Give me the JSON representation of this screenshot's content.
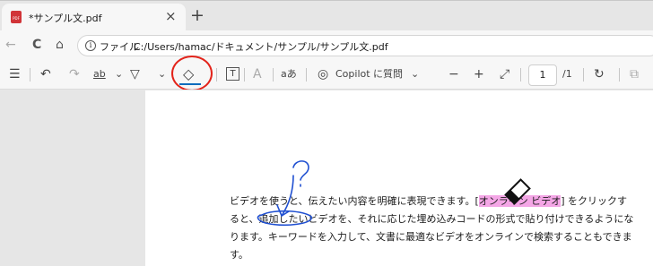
{
  "tab": {
    "title": "*サンプル文.pdf",
    "close": "×",
    "new_tab": "+"
  },
  "address": {
    "back": "←",
    "refresh": "C",
    "home": "⌂",
    "info": "i",
    "file_label": "ファイル",
    "url": "C:/Users/hamac/ドキュメント/サンプル/サンプル文.pdf"
  },
  "toolbar": {
    "contents": "☰",
    "undo": "↶",
    "redo": "↷",
    "highlight": "ab",
    "draw": "▽",
    "chevron": "⌄",
    "erase": "◇",
    "text": "T",
    "read_aloud": "A",
    "translate": "aあ",
    "copilot": "Copilot に質問",
    "zoom_out": "−",
    "zoom_in": "+",
    "fit": "⤢",
    "page_current": "1",
    "page_total": "/1",
    "rotate": "↻",
    "two_page": "⧉"
  },
  "document": {
    "line1a": "ビデオを使うと、伝えたい内容を明確に表現できます。[",
    "line1b": "オンライン ビデオ",
    "line1c": "] をクリックす",
    "line2": "ると、追加したいビデオを、それに応じた埋め込みコードの形式で貼り付けできるようにな",
    "line3": "ります。キーワードを入力して、文書に最適なビデオをオンラインで検索することもできま",
    "line4": "す。"
  },
  "annotations": {
    "ink_color": "#1f4fd1",
    "highlight_color": "#f4a6e6",
    "callout_color": "#e3241b"
  }
}
